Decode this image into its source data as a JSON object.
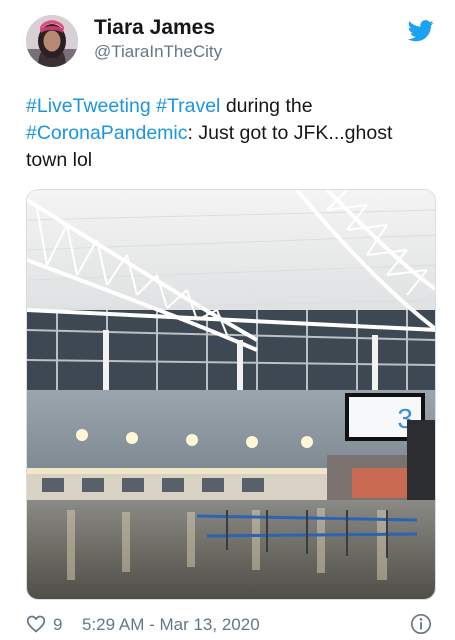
{
  "tweet": {
    "author_name": "Tiara James",
    "author_handle": "@TiaraInTheCity",
    "text": {
      "tag1": "#LiveTweeting",
      "sep1": " ",
      "tag2": "#Travel",
      "plain1": " during the ",
      "tag3": "#CoronaPandemic",
      "plain2": ": Just got to JFK...ghost town lol"
    },
    "media": {
      "gate_sign_number": "3"
    },
    "likes_count": "9",
    "timestamp": "5:29 AM - Mar 13, 2020"
  },
  "icons": {
    "platform": "bird-logo-icon",
    "like": "heart-icon",
    "info": "info-icon"
  },
  "colors": {
    "link": "#1b95e0",
    "brand": "#1da1f2",
    "meta_text": "#657786"
  }
}
